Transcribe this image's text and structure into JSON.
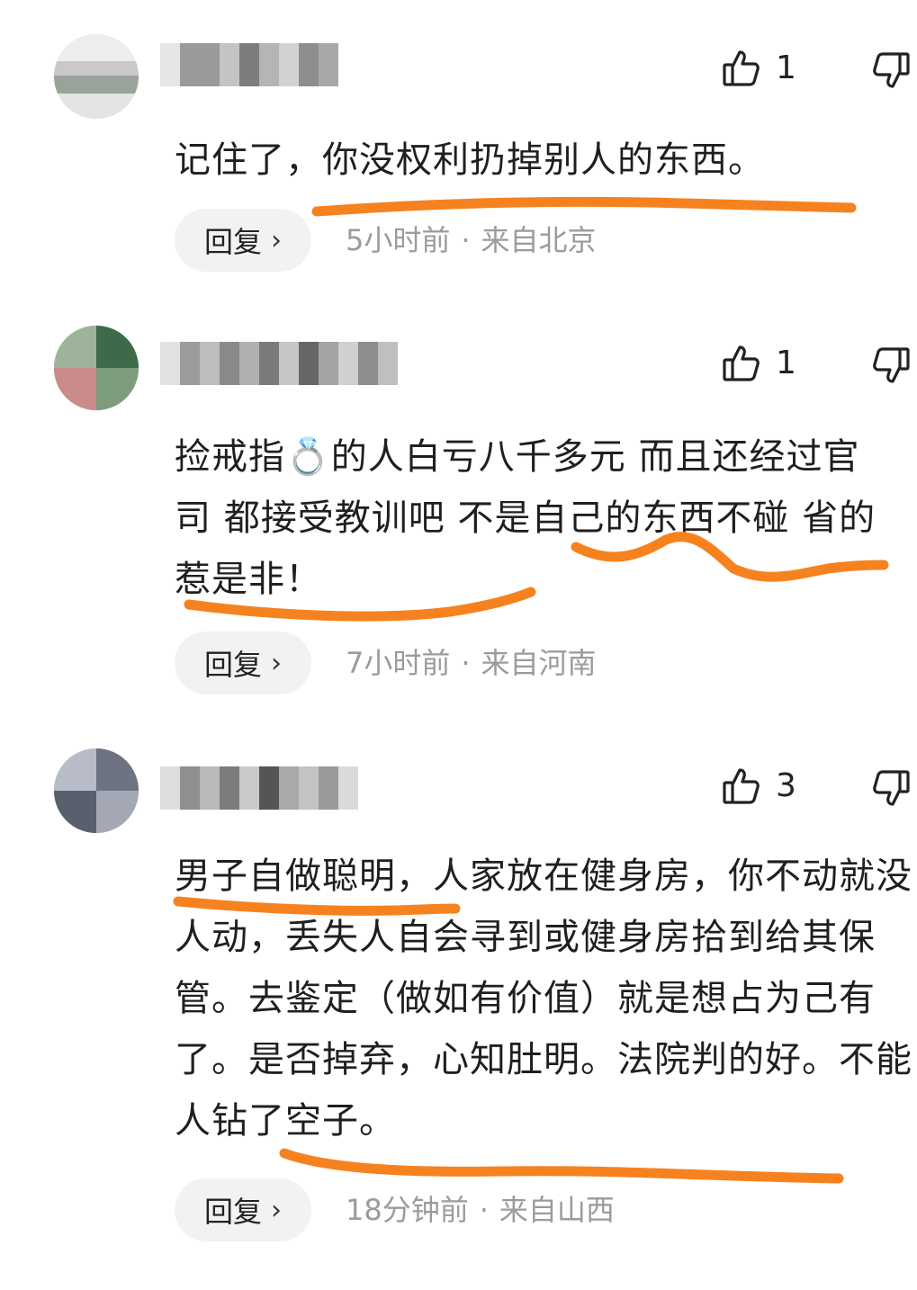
{
  "comments": [
    {
      "likes": "1",
      "text": "记住了，你没权利扔掉别人的东西。",
      "reply_label": "回复",
      "time": "5小时前",
      "location": "来自北京"
    },
    {
      "likes": "1",
      "text": "捡戒指💍的人白亏八千多元 而且还经过官司 都接受教训吧 不是自己的东西不碰 省的惹是非！",
      "reply_label": "回复",
      "time": "7小时前",
      "location": "来自河南"
    },
    {
      "likes": "3",
      "text": "男子自做聪明，人家放在健身房，你不动就没人动，丢失人自会寻到或健身房拾到给其保管。去鉴定（做如有价值）就是想占为己有了。是否掉弃，心知肚明。法院判的好。不能人钻了空子。",
      "reply_label": "回复",
      "time": "18分钟前",
      "location": "来自山西"
    }
  ],
  "separator": "·",
  "icons": {
    "like": "thumbs-up-icon",
    "dislike": "thumbs-down-icon",
    "reply_chevron": "chevron-right-icon"
  },
  "colors": {
    "highlight_stroke": "#f6821f",
    "meta_text": "#9b9b9b",
    "reply_bg": "#f2f2f2"
  }
}
